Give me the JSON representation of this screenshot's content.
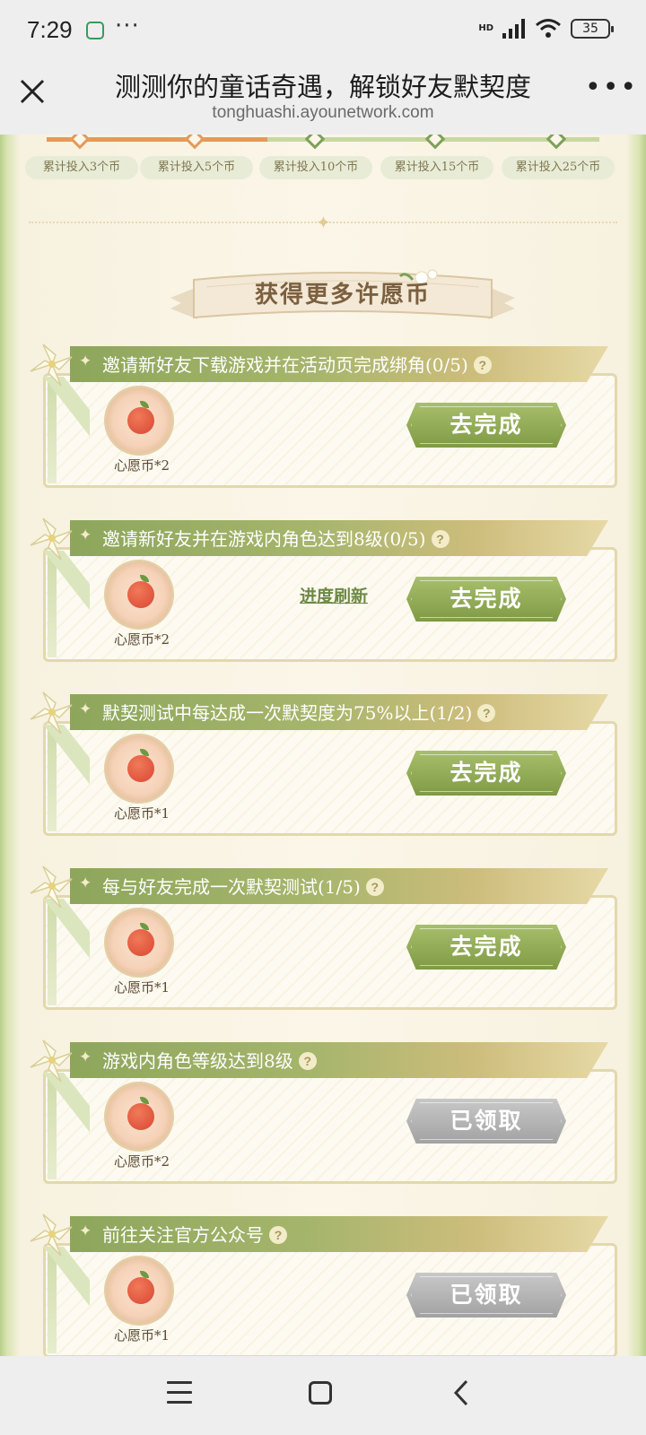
{
  "status_bar": {
    "time": "7:29",
    "dots": "···",
    "network": "HD",
    "battery": "35"
  },
  "header": {
    "title": "测测你的童话奇遇，解锁好友默契度",
    "url": "tonghuashi.ayounetwork.com"
  },
  "progress": {
    "filled_tiers": 2
  },
  "tiers": [
    "累计投入3个币",
    "累计投入5个币",
    "累计投入10个币",
    "累计投入15个币",
    "累计投入25个币"
  ],
  "section_title": "获得更多许愿币",
  "tasks": [
    {
      "title": "邀请新好友下载游戏并在活动页完成绑角(0/5)",
      "reward": "心愿币*2",
      "action": "去完成",
      "status": "todo",
      "refresh": ""
    },
    {
      "title": "邀请新好友并在游戏内角色达到8级(0/5)",
      "reward": "心愿币*2",
      "action": "去完成",
      "status": "todo",
      "refresh": "进度刷新"
    },
    {
      "title": "默契测试中每达成一次默契度为75%以上(1/2)",
      "reward": "心愿币*1",
      "action": "去完成",
      "status": "todo",
      "refresh": ""
    },
    {
      "title": "每与好友完成一次默契测试(1/5)",
      "reward": "心愿币*1",
      "action": "去完成",
      "status": "todo",
      "refresh": ""
    },
    {
      "title": "游戏内角色等级达到8级",
      "reward": "心愿币*2",
      "action": "已领取",
      "status": "done",
      "refresh": ""
    },
    {
      "title": "前往关注官方公众号",
      "reward": "心愿币*1",
      "action": "已领取",
      "status": "done",
      "refresh": ""
    }
  ],
  "icons": {
    "close": "close-icon",
    "more": "more-icon",
    "help": "question-icon",
    "menu": "menu-icon",
    "home": "home-icon",
    "back": "back-icon"
  },
  "colors": {
    "accent_green": "#8da65c",
    "progress_orange": "#e29a5a",
    "done_gray": "#a2a2a2"
  }
}
